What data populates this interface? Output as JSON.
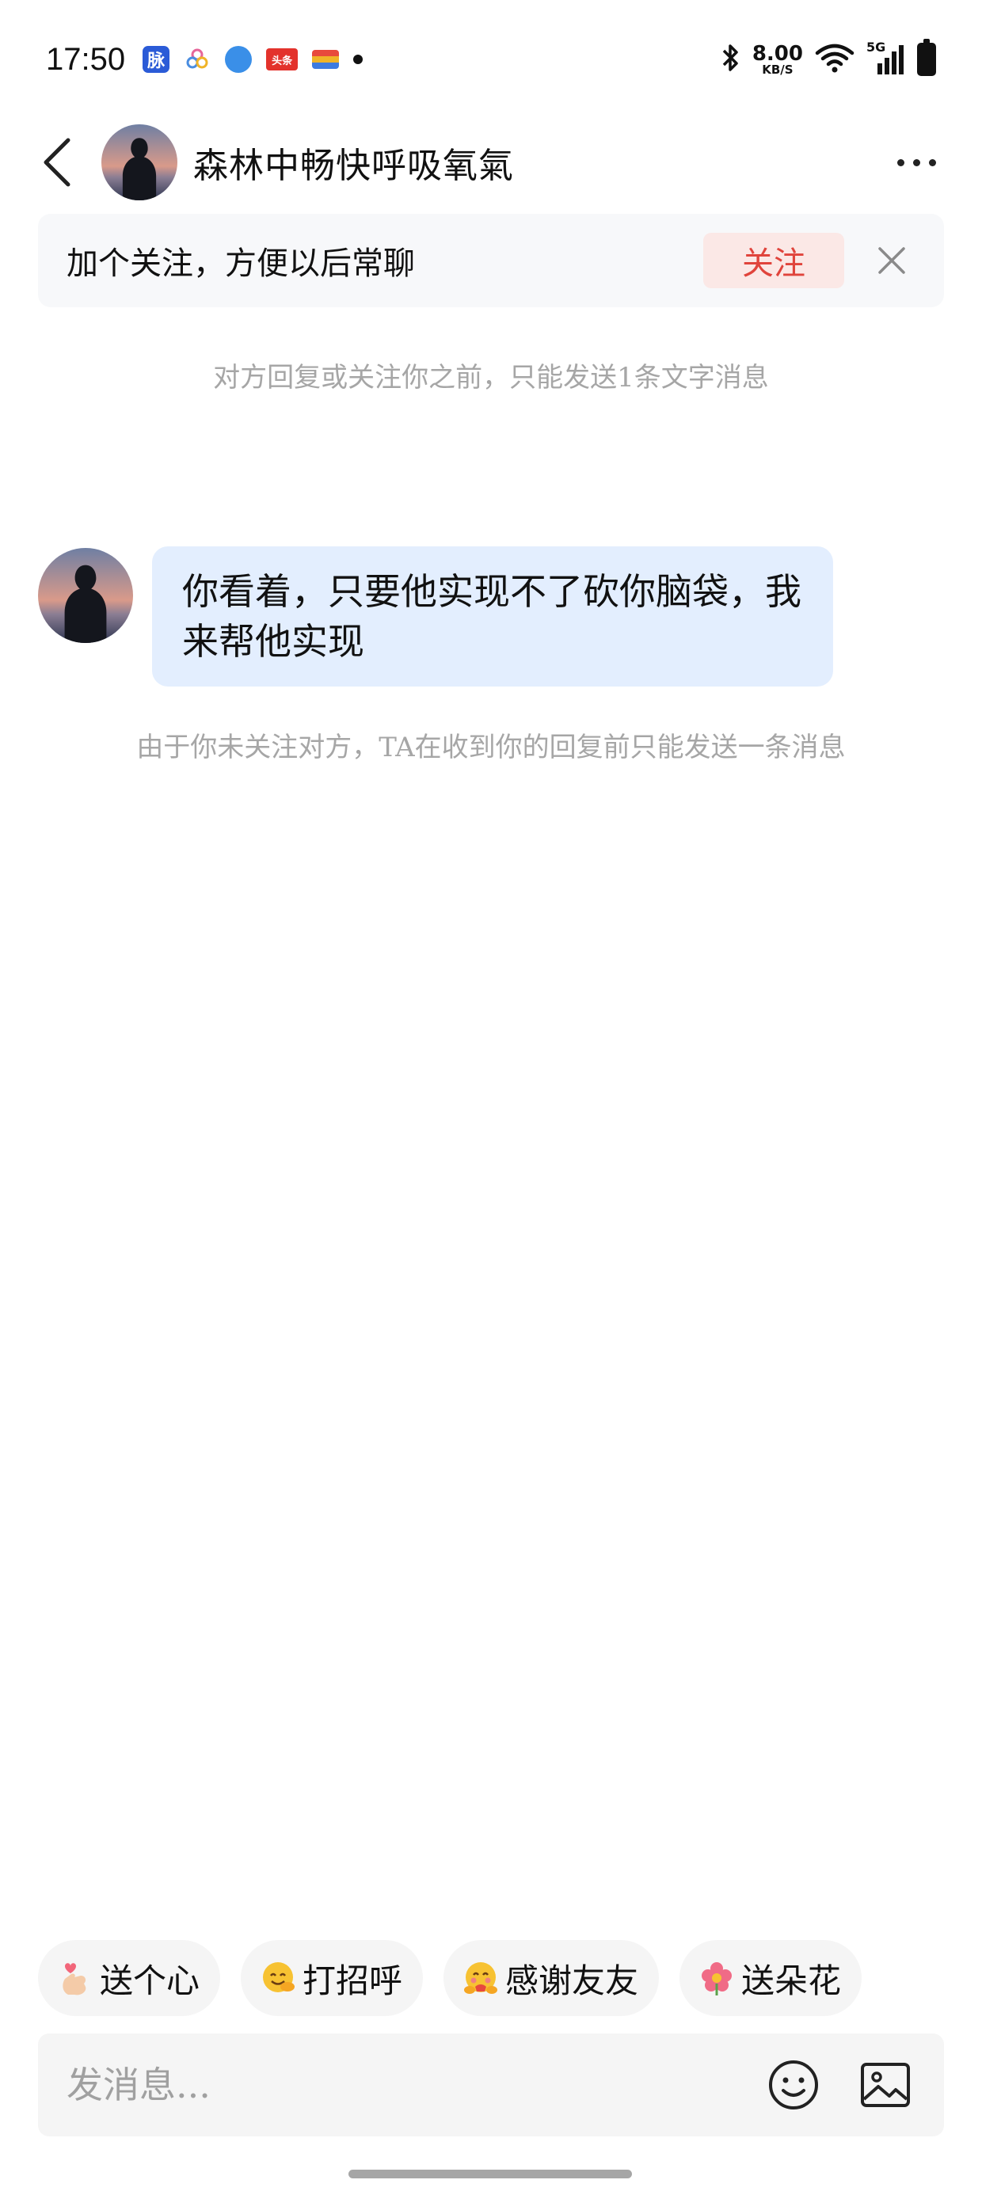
{
  "status_bar": {
    "time": "17:50",
    "notification_icons": [
      "mai-icon",
      "flower-app-icon",
      "leaf-app-icon",
      "toutiao-icon",
      "wallet-card-icon",
      "more-notifications-dot"
    ],
    "mai_label": "脉",
    "toutiao_label": "头条",
    "net_speed_value": "8.00",
    "net_speed_unit": "KB/S",
    "network_label": "5G"
  },
  "header": {
    "title": "森林中畅快呼吸氧氣",
    "back_icon": "chevron-left-icon",
    "more_icon": "more-dots-icon"
  },
  "follow_banner": {
    "text": "加个关注，方便以后常聊",
    "follow_label": "关注",
    "close_icon": "close-icon",
    "accent_color": "#e0443c"
  },
  "notices": {
    "top": "对方回复或关注你之前，只能发送1条文字消息",
    "bottom": "由于你未关注对方，TA在收到你的回复前只能发送一条消息"
  },
  "messages": [
    {
      "sender": "other",
      "text": "你看着，只要他实现不了砍你脑袋，我来帮他实现"
    }
  ],
  "quick_replies": [
    {
      "emoji": "finger-heart-emoji",
      "label": "送个心"
    },
    {
      "emoji": "smiling-hug-emoji",
      "label": "打招呼"
    },
    {
      "emoji": "hugging-face-emoji",
      "label": "感谢友友"
    },
    {
      "emoji": "flower-emoji",
      "label": "送朵花"
    }
  ],
  "input": {
    "placeholder": "发消息...",
    "value": "",
    "emoji_icon": "smiley-icon",
    "image_icon": "image-icon"
  },
  "colors": {
    "bubble_bg": "#e3eefe",
    "banner_bg": "#f7f8fa",
    "follow_btn_bg": "#fbe8e6"
  }
}
